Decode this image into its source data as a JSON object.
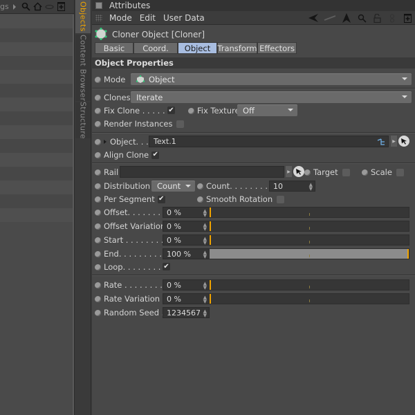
{
  "left_panel": {
    "toolbar_label": "gs",
    "icons": [
      "search-icon",
      "home-icon",
      "ellipse-icon",
      "new-panel-icon"
    ],
    "row_count": 15
  },
  "vertical_tabs": [
    {
      "label": "Objects",
      "active": true
    },
    {
      "label": "Content Browser",
      "active": false
    },
    {
      "label": "Structure",
      "active": false
    }
  ],
  "attributes": {
    "title": "Attributes",
    "menu": [
      "Mode",
      "Edit",
      "User Data"
    ],
    "tool_icons": [
      "back-arrow-icon",
      "forward-arrow-icon",
      "up-arrow-icon",
      "search-icon",
      "lock-icon",
      "link-icon",
      "new-panel-icon"
    ],
    "object_title": "Cloner Object [Cloner]",
    "tabs": [
      {
        "label": "Basic",
        "active": false
      },
      {
        "label": "Coord.",
        "active": false
      },
      {
        "label": "Object",
        "active": true
      },
      {
        "label": "Transform",
        "active": false
      },
      {
        "label": "Effectors",
        "active": false
      }
    ],
    "section": "Object Properties",
    "mode": {
      "label": "Mode",
      "value": "Object"
    },
    "clones": {
      "label": "Clones",
      "value": "Iterate"
    },
    "fix_clone": {
      "label": "Fix Clone . . . . . .",
      "checked": true
    },
    "fix_texture": {
      "label": "Fix Texture",
      "value": "Off"
    },
    "render_instances": {
      "label": "Render Instances",
      "checked": false
    },
    "object": {
      "label": "Object. . .",
      "value": "Text.1"
    },
    "align_clone": {
      "label": "Align Clone",
      "checked": true
    },
    "rail": {
      "label": "Rail",
      "value": ""
    },
    "target": {
      "label": "Target",
      "checked": false
    },
    "scale": {
      "label": "Scale",
      "checked": false
    },
    "distribution": {
      "label": "Distribution",
      "value": "Count"
    },
    "count": {
      "label": "Count. . . . . . . . . .",
      "value": "10"
    },
    "per_segment": {
      "label": "Per Segment",
      "checked": true
    },
    "smooth_rotation": {
      "label": "Smooth Rotation",
      "checked": false
    },
    "sliders": [
      {
        "label": "Offset. . . . . . . .",
        "value": "0 %",
        "fraction": 0.0
      },
      {
        "label": "Offset Variation",
        "value": "0 %",
        "fraction": 0.0
      },
      {
        "label": "Start . . . . . . . . .",
        "value": "0 %",
        "fraction": 0.0
      },
      {
        "label": "End. . . . . . . . . .",
        "value": "100 %",
        "fraction": 1.0
      }
    ],
    "loop": {
      "label": "Loop. . . . . . . . .",
      "checked": true
    },
    "rate_sliders": [
      {
        "label": "Rate . . . . . . . . .",
        "value": "0 %",
        "fraction": 0.0
      },
      {
        "label": "Rate Variation",
        "value": "0 %",
        "fraction": 0.0
      }
    ],
    "random_seed": {
      "label": "Random Seed .",
      "value": "1234567"
    },
    "check_glyph": "✔",
    "accent_color": "#f0a400",
    "active_tab_color": "#a8bde0"
  }
}
